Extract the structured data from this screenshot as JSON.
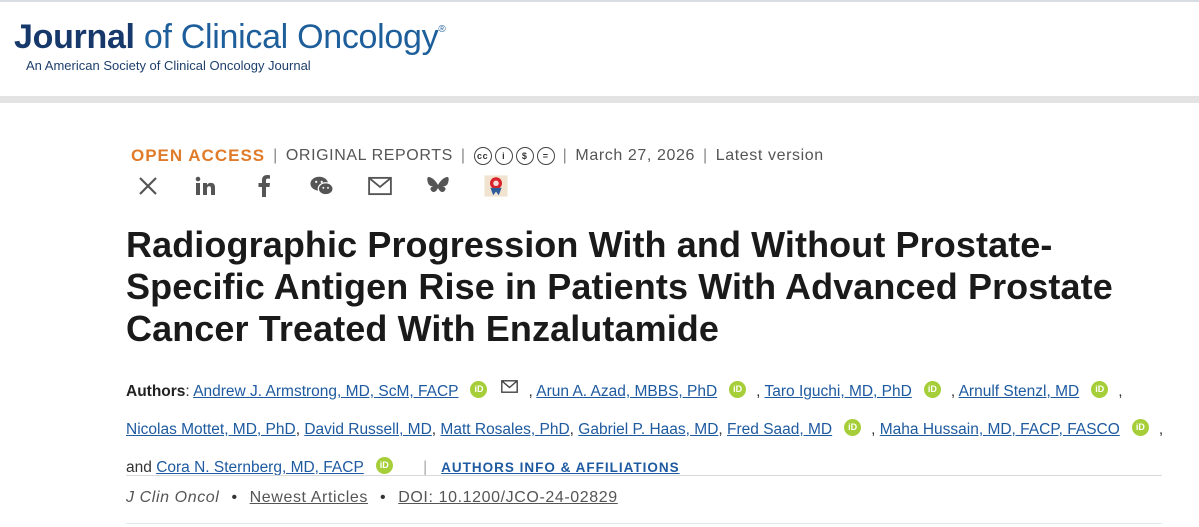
{
  "header": {
    "logo_bold": "Journal",
    "logo_rest": " of Clinical Oncology",
    "logo_mark": "®",
    "logo_subtitle": "An American Society of Clinical Oncology Journal"
  },
  "meta": {
    "access": "OPEN ACCESS",
    "type": "ORIGINAL REPORTS",
    "license_icons": [
      "cc-icon",
      "by-icon",
      "nc-icon",
      "nd-icon"
    ],
    "license_glyphs": [
      "cc",
      "i",
      "$",
      "="
    ],
    "date": "March 27, 2026",
    "version": "Latest version"
  },
  "share_icons": [
    "x-icon",
    "linkedin-icon",
    "facebook-icon",
    "wechat-icon",
    "email-icon",
    "bluesky-icon",
    "mendeley-icon"
  ],
  "article": {
    "title": "Radiographic Progression With and Without Prostate-Specific Antigen Rise in Patients With Advanced Prostate Cancer Treated With Enzalutamide"
  },
  "authors": {
    "label": "Authors",
    "list": [
      "Andrew J. Armstrong, MD, ScM, FACP",
      "Arun A. Azad, MBBS, PhD",
      "Taro Iguchi, MD, PhD",
      "Arnulf Stenzl, MD",
      "Nicolas Mottet, MD, PhD",
      "David Russell, MD",
      "Matt Rosales, PhD",
      "Gabriel P. Haas, MD",
      "Fred Saad, MD",
      "Maha Hussain, MD, FACP, FASCO",
      "Cora N. Sternberg, MD, FACP"
    ],
    "orcid_label": "iD",
    "and_text": "and",
    "info_link": "AUTHORS INFO & AFFILIATIONS"
  },
  "citation": {
    "journal": "J Clin Oncol",
    "section": "Newest Articles",
    "doi": "DOI: 10.1200/JCO-24-02829"
  }
}
